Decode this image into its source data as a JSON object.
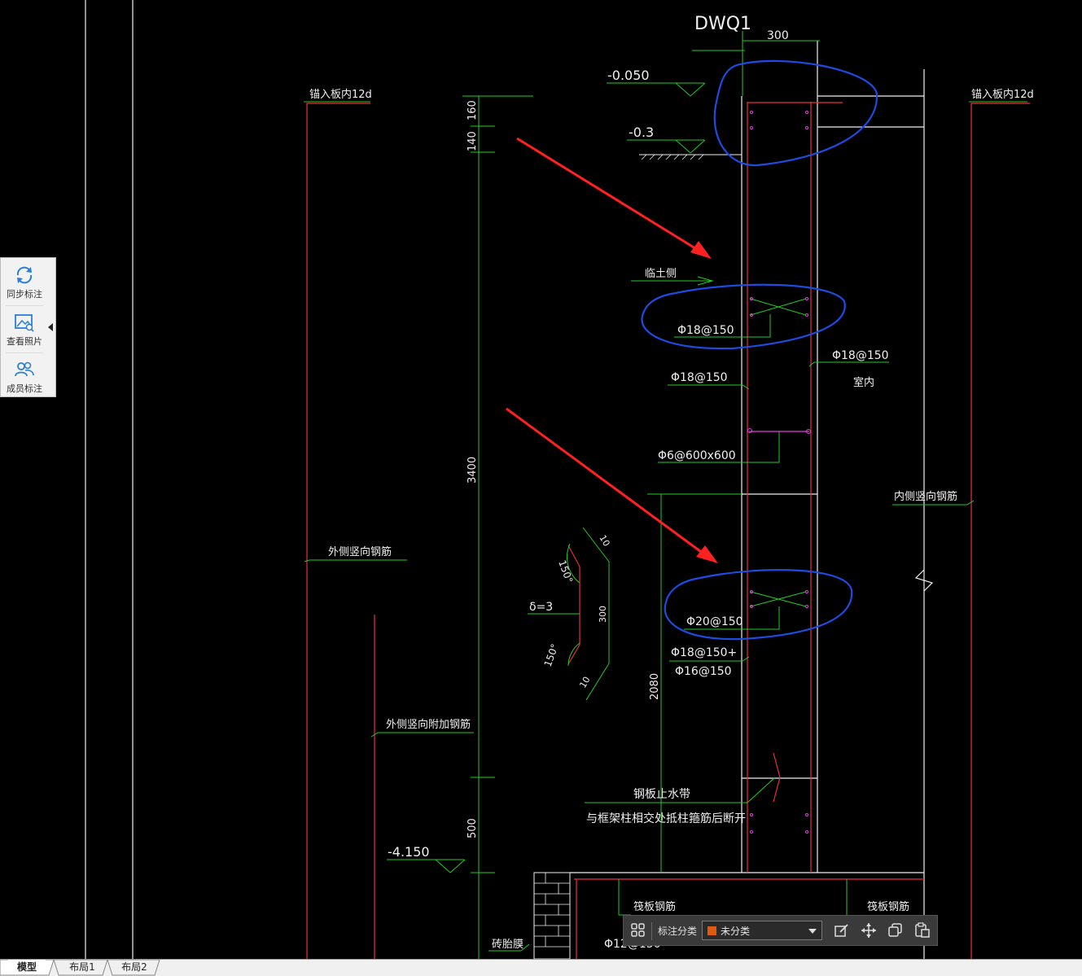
{
  "drawing": {
    "title": "DWQ1",
    "dim_top": "300",
    "elev_top": "-0.050",
    "elev_ground": "-0.3",
    "elev_bottom": "-4.150",
    "dim_160": "160",
    "dim_140": "140",
    "dim_3400": "3400",
    "dim_2080": "2080",
    "dim_500": "500",
    "dim_10a": "10",
    "dim_10b": "10",
    "dim_300b": "300",
    "angle_a": "150°",
    "angle_b": "150°",
    "delta": "δ=3",
    "anchor_left": "锚入板内12d",
    "anchor_right": "锚入板内12d",
    "soil_side": "临土侧",
    "rebar_1": "Φ18@150",
    "rebar_2": "Φ18@150",
    "rebar_3": "Φ18@150",
    "indoor": "室内",
    "tie_bar": "Φ6@600x600",
    "inner_vertical": "内侧竖向钢筋",
    "outer_vertical": "外侧竖向钢筋",
    "rebar_20": "Φ20@150",
    "rebar_18b": "Φ18@150+",
    "rebar_16": "Φ16@150",
    "outer_additional": "外侧竖向附加钢筋",
    "waterstop_1": "钢板止水带",
    "waterstop_2": "与框架柱相交处抵柱箍筋后断开",
    "raft_left": "筏板钢筋",
    "raft_right": "筏板钢筋",
    "brick_form": "砖胎膜",
    "rebar_12": "Φ12@150"
  },
  "side_panel": {
    "sync_label": "同步标注",
    "photo_label": "查看照片",
    "member_label": "成员标注"
  },
  "annotation_bar": {
    "label": "标注分类",
    "selected": "未分类",
    "swatch_color": "#e05a12"
  },
  "tabs": {
    "model": "模型",
    "layout1": "布局1",
    "layout2": "布局2"
  },
  "colors": {
    "green": "#22cc22",
    "red": "#e8303a",
    "white": "#f0f0f0",
    "blue": "#1e4be0",
    "magenta": "#e040e0"
  }
}
